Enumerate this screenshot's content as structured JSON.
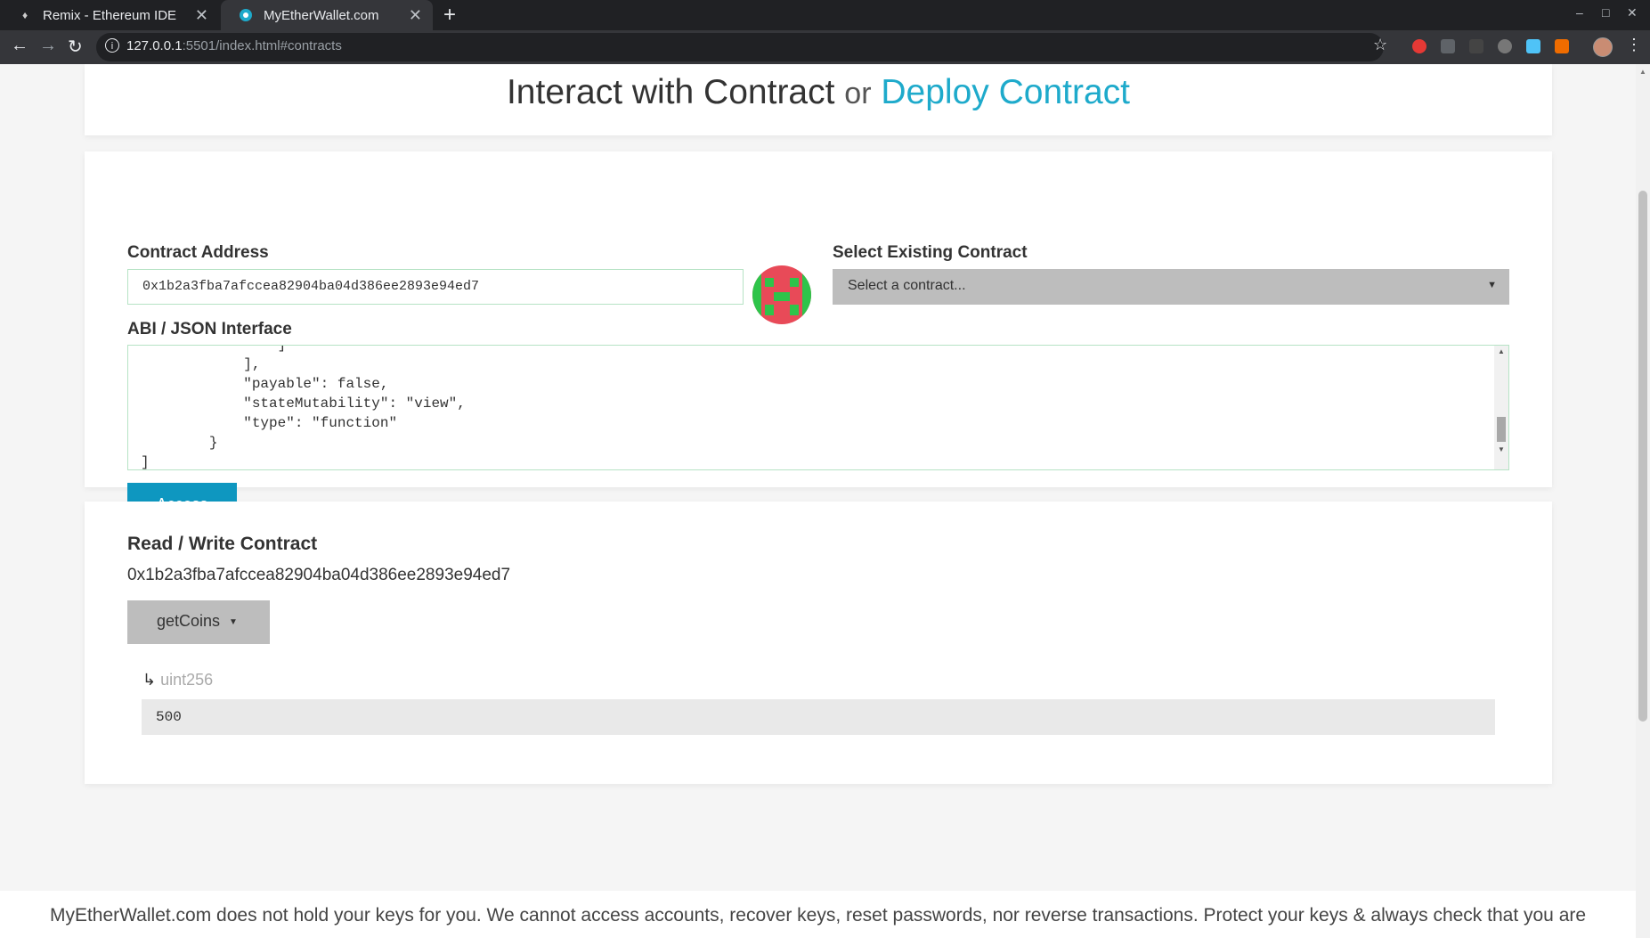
{
  "browser": {
    "tabs": [
      {
        "title": "Remix - Ethereum IDE",
        "active": false
      },
      {
        "title": "MyEtherWallet.com",
        "active": true
      }
    ],
    "url": {
      "host": "127.0.0.1",
      "rest": ":5501/index.html#contracts"
    },
    "icons": {
      "back": "back-arrow-icon",
      "forward": "forward-arrow-icon",
      "reload": "reload-icon",
      "star": "star-icon",
      "menu": "kebab-menu-icon"
    }
  },
  "page": {
    "heading": {
      "main": "Interact with Contract",
      "or": "or",
      "link": "Deploy Contract"
    },
    "contract_address_label": "Contract Address",
    "contract_address_value": "0x1b2a3fba7afccea82904ba04d386ee2893e94ed7",
    "select_label": "Select Existing Contract",
    "select_value": "Select a contract...",
    "abi_label": "ABI / JSON Interface",
    "abi_text": "                ]\n            ],\n            \"payable\": false,\n            \"stateMutability\": \"view\",\n            \"type\": \"function\"\n        }\n]",
    "access_button": "Access",
    "rw_title": "Read / Write Contract",
    "rw_address": "0x1b2a3fba7afccea82904ba04d386ee2893e94ed7",
    "function_selected": "getCoins",
    "output_arrow": "↳",
    "output_type": "uint256",
    "output_value": "500",
    "footer_text": "MyEtherWallet.com does not hold your keys for you. We cannot access accounts, recover keys, reset passwords, nor reverse transactions. Protect your keys & always check that you are"
  },
  "colors": {
    "accent": "#1eaacb",
    "button": "#0e97c0",
    "input_border": "#b6e3c5"
  }
}
